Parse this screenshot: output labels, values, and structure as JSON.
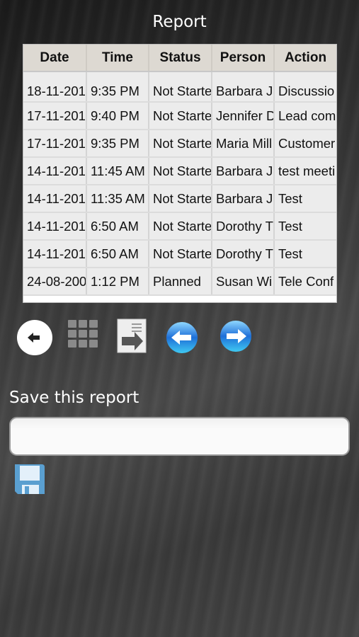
{
  "header": {
    "title": "Report"
  },
  "table": {
    "columns": [
      "Date",
      "Time",
      "Status",
      "Person",
      "Action"
    ],
    "rows": [
      [
        "18-11-201",
        "9:35 PM",
        "Not Starte",
        "Barbara J",
        "Discussio"
      ],
      [
        "17-11-201",
        "9:40 PM",
        "Not Starte",
        "Jennifer D",
        "Lead com"
      ],
      [
        "17-11-201",
        "9:35 PM",
        "Not Starte",
        "Maria Mill",
        "Customer"
      ],
      [
        "14-11-201",
        "11:45 AM",
        "Not Starte",
        "Barbara J",
        "test meeti"
      ],
      [
        "14-11-201",
        "11:35 AM",
        "Not Starte",
        "Barbara J",
        "Test"
      ],
      [
        "14-11-201",
        "6:50 AM",
        "Not Starte",
        "Dorothy T",
        "Test"
      ],
      [
        "14-11-201",
        "6:50 AM",
        "Not Starte",
        "Dorothy T",
        "Test"
      ],
      [
        "24-08-200",
        "1:12 PM",
        "Planned",
        "Susan Wi",
        "Tele Conf"
      ]
    ]
  },
  "toolbar": {
    "icons": [
      "back-icon",
      "grid-menu-icon",
      "export-document-icon",
      "previous-page-icon",
      "next-page-icon"
    ]
  },
  "save": {
    "label": "Save this report",
    "input_value": "",
    "input_placeholder": "",
    "icon": "floppy-disk-icon"
  },
  "colors": {
    "header_bg": "#ddd9d2",
    "cell_bg": "#ececec",
    "nav_arrow_blue": "#1e6fd8",
    "floppy_blue": "#5a9fd0"
  }
}
